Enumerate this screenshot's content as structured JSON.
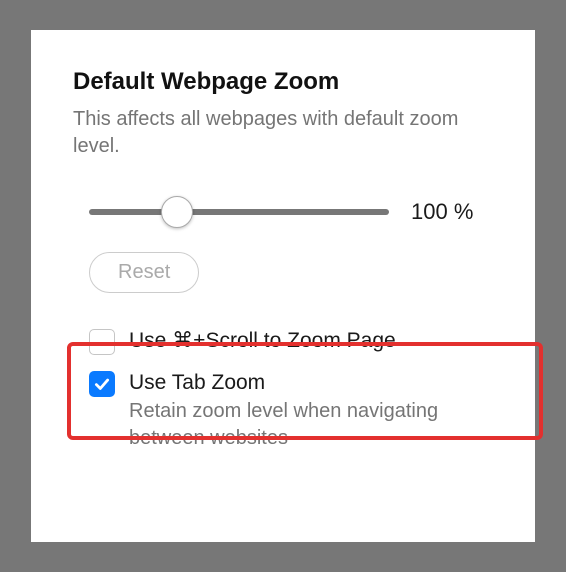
{
  "title": "Default Webpage Zoom",
  "subtitle": "This affects all webpages with default zoom level.",
  "zoom": {
    "value_label": "100 %",
    "reset_label": "Reset"
  },
  "options": {
    "cmd_scroll": {
      "label": "Use ⌘+Scroll to Zoom Page",
      "checked": false
    },
    "tab_zoom": {
      "label": "Use Tab Zoom",
      "description": "Retain zoom level when navigating between websites",
      "checked": true
    }
  }
}
